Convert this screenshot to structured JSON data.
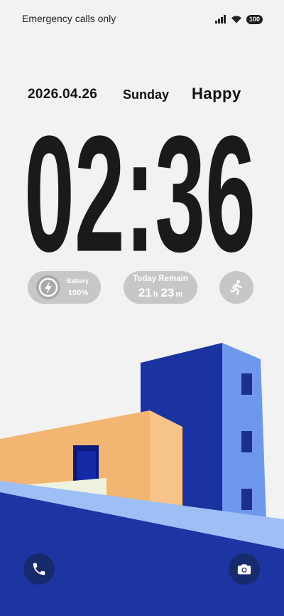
{
  "status_bar": {
    "carrier_text": "Emergency calls only",
    "battery_level": "100",
    "signal_icon": "signal-icon",
    "wifi_icon": "wifi-icon"
  },
  "lock_screen": {
    "date": "2026.04.26",
    "weekday": "Sunday",
    "mood": "Happy",
    "time": "02:36"
  },
  "widgets": {
    "battery": {
      "label": "Battery",
      "value": "100%",
      "icon": "lightning-bolt-icon"
    },
    "today_remain": {
      "label": "Today Remain",
      "hours": "21",
      "hours_unit": "h",
      "minutes": "23",
      "minutes_unit": "m"
    },
    "activity": {
      "icon": "running-person-icon"
    }
  },
  "shortcuts": {
    "left": {
      "icon": "phone-icon"
    },
    "right": {
      "icon": "camera-icon"
    }
  },
  "colors": {
    "background": "#f2f2f3",
    "clock_text": "#1a1a1a",
    "widget_pill": "#c7c7c7",
    "building_navy": "#1b33a0",
    "building_light_blue": "#6d98ec",
    "building_orange": "#f3b672",
    "shortcut_bg": "#172a6b"
  }
}
